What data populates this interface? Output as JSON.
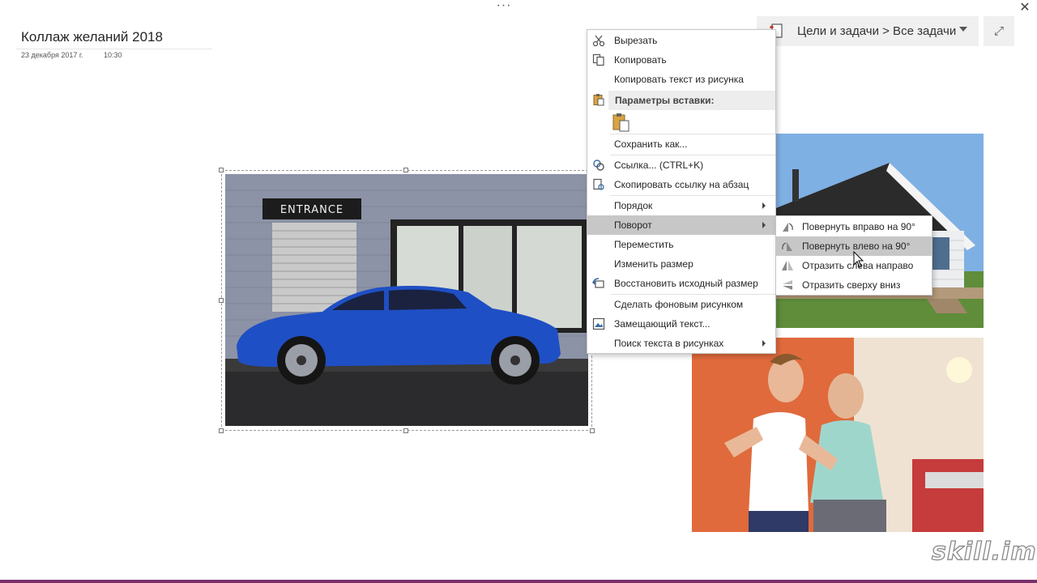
{
  "window": {
    "dots": "···",
    "close": "✕",
    "expand": "⤢"
  },
  "page": {
    "title": "Коллаж желаний 2018",
    "date": "23 декабря 2017 г.",
    "time": "10:30"
  },
  "tag": {
    "label": "Цели и задачи > Все задачи"
  },
  "context_menu": {
    "cut": "Вырезать",
    "copy": "Копировать",
    "copy_text": "Копировать текст из рисунка",
    "paste_options": "Параметры вставки:",
    "save_as": "Сохранить как...",
    "link": "Ссылка...  (CTRL+K)",
    "copy_link": "Скопировать ссылку на абзац",
    "order": "Порядок",
    "rotate": "Поворот",
    "move": "Переместить",
    "resize": "Изменить размер",
    "restore_size": "Восстановить исходный размер",
    "set_background": "Сделать фоновым рисунком",
    "alt_text": "Замещающий текст...",
    "search_text": "Поиск текста в рисунках"
  },
  "rotate_submenu": {
    "rotate_right": "Повернуть вправо на 90°",
    "rotate_left": "Повернуть влево на 90°",
    "flip_horizontal": "Отразить слева направо",
    "flip_vertical": "Отразить сверху вниз"
  },
  "photos": {
    "car_sign": "ENTRANCE"
  },
  "watermark": "skill.im",
  "colors": {
    "accent": "#7a2f6b",
    "menu_highlight": "#c7c7c7",
    "car_blue": "#1f4fc4"
  }
}
